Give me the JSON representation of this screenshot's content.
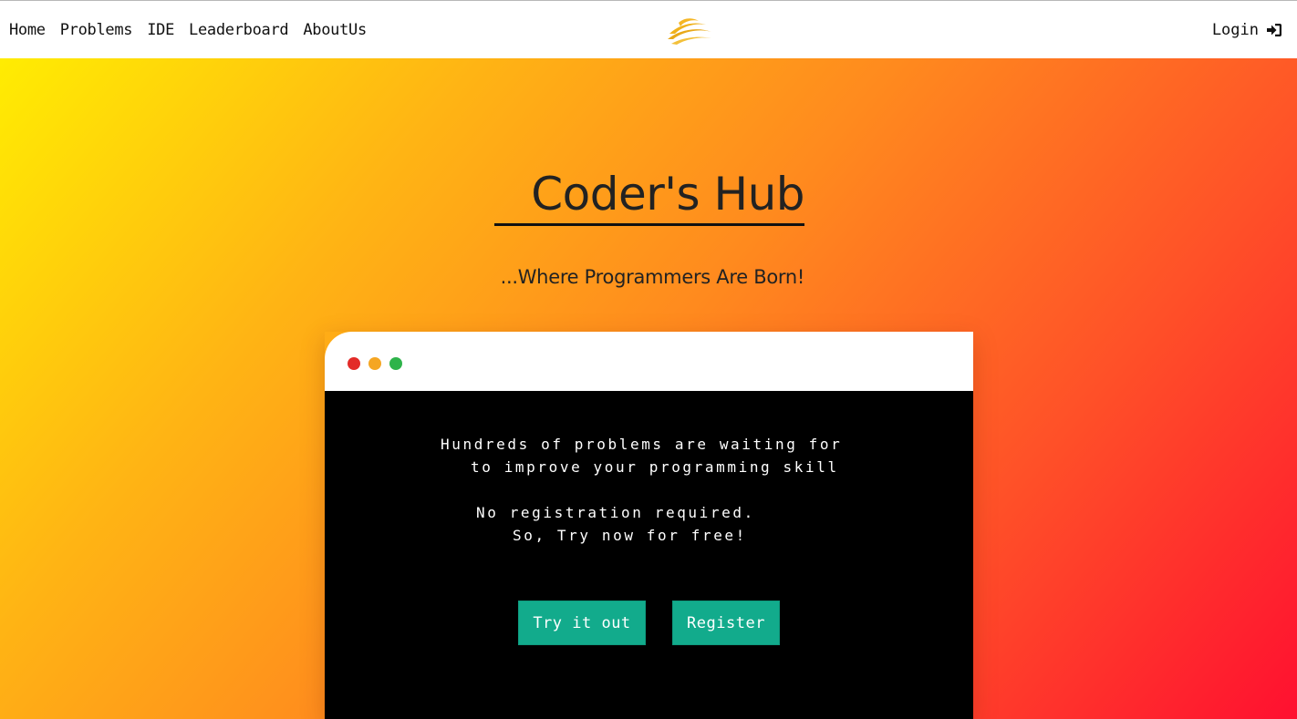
{
  "nav": {
    "links": [
      "Home",
      "Problems",
      "IDE",
      "Leaderboard",
      "AboutUs"
    ],
    "login_label": "Login",
    "logo_icon": "swoosh-logo-icon",
    "login_icon": "sign-in-icon"
  },
  "hero": {
    "title": "Coder's Hub",
    "subtitle": "...Where Programmers Are Born!"
  },
  "terminal": {
    "window_dots": [
      "#e32b28",
      "#f5a623",
      "#2eb34a"
    ],
    "lines": [
      "Hundreds of problems are waiting for",
      "to improve your programming skill",
      "No registration required.",
      "So, Try now for free!"
    ],
    "buttons": {
      "try": "Try it out",
      "register": "Register"
    }
  },
  "colors": {
    "button": "#12ab8c",
    "logo": "#f0b21c",
    "gradient_start": "#fff200",
    "gradient_end": "#ff1030"
  }
}
